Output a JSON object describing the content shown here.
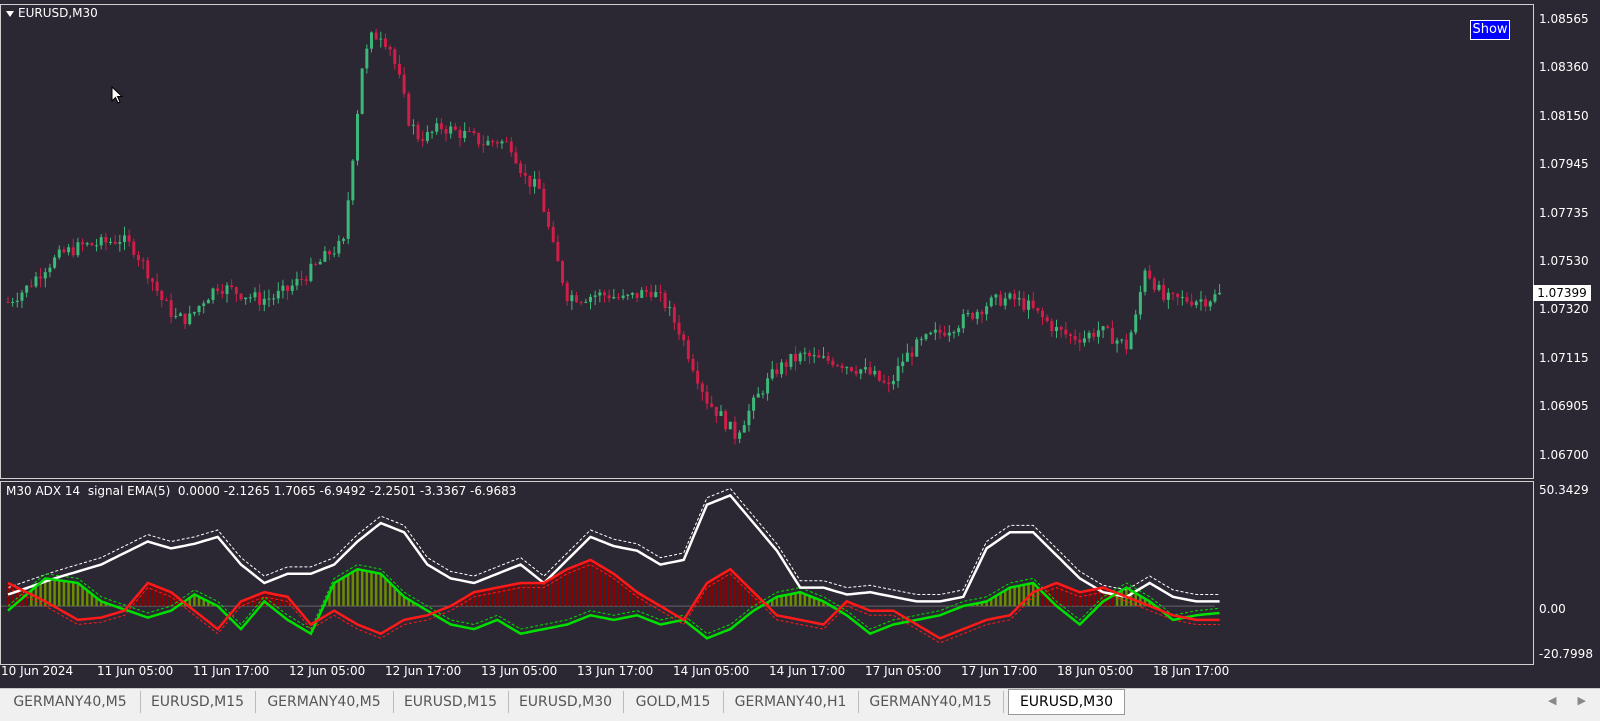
{
  "chart_title": "EURUSD,M30",
  "show_button": "Show",
  "indicator_label": "M30 ADX 14  signal EMA(5)  0.0000 -2.1265 1.7065 -6.9492 -2.2501 -3.3367 -6.9683",
  "price_axis": [
    "1.08565",
    "1.08360",
    "1.08150",
    "1.07945",
    "1.07735",
    "1.07530",
    "1.07320",
    "1.07115",
    "1.06905",
    "1.06700"
  ],
  "current_price": "1.07399",
  "indicator_axis": [
    "50.3429",
    "0.00",
    "-20.7998"
  ],
  "time_axis": [
    "10 Jun 2024",
    "11 Jun 05:00",
    "11 Jun 17:00",
    "12 Jun 05:00",
    "12 Jun 17:00",
    "13 Jun 05:00",
    "13 Jun 17:00",
    "14 Jun 05:00",
    "14 Jun 17:00",
    "17 Jun 05:00",
    "17 Jun 17:00",
    "18 Jun 05:00",
    "18 Jun 17:00"
  ],
  "tabs": [
    {
      "label": "GERMANY40,M5",
      "active": false
    },
    {
      "label": "EURUSD,M15",
      "active": false
    },
    {
      "label": "GERMANY40,M5",
      "active": false
    },
    {
      "label": "EURUSD,M15",
      "active": false
    },
    {
      "label": "EURUSD,M30",
      "active": false
    },
    {
      "label": "GOLD,M15",
      "active": false
    },
    {
      "label": "GERMANY40,H1",
      "active": false
    },
    {
      "label": "GERMANY40,M15",
      "active": false
    },
    {
      "label": "EURUSD,M30",
      "active": true
    }
  ],
  "colors": {
    "background": "#2b2733",
    "bull": "#3cb878",
    "bear": "#d01e48",
    "adx": "#ffffff",
    "plus_di": "#00e000",
    "minus_di": "#ff1a1a",
    "hist_bull": "#6b8c00",
    "hist_bear": "#8b0000",
    "accent": "#0000ff"
  },
  "chart_data": {
    "type": "candlestick",
    "ylim": [
      1.0665,
      1.0862
    ],
    "price_path": [
      [
        0,
        1.0737
      ],
      [
        4,
        1.0743
      ],
      [
        8,
        1.0752
      ],
      [
        12,
        1.0758
      ],
      [
        16,
        1.0761
      ],
      [
        20,
        1.0762
      ],
      [
        24,
        1.0764
      ],
      [
        27,
        1.076
      ],
      [
        30,
        1.075
      ],
      [
        33,
        1.0738
      ],
      [
        36,
        1.073
      ],
      [
        39,
        1.073
      ],
      [
        42,
        1.0738
      ],
      [
        45,
        1.0744
      ],
      [
        48,
        1.0742
      ],
      [
        51,
        1.074
      ],
      [
        54,
        1.0738
      ],
      [
        57,
        1.0739
      ],
      [
        60,
        1.0742
      ],
      [
        63,
        1.0747
      ],
      [
        66,
        1.0752
      ],
      [
        69,
        1.0758
      ],
      [
        72,
        1.0762
      ],
      [
        74,
        1.08
      ],
      [
        76,
        1.0838
      ],
      [
        78,
        1.085
      ],
      [
        80,
        1.0852
      ],
      [
        82,
        1.0846
      ],
      [
        84,
        1.0832
      ],
      [
        86,
        1.0815
      ],
      [
        88,
        1.0808
      ],
      [
        90,
        1.0808
      ],
      [
        93,
        1.0812
      ],
      [
        96,
        1.081
      ],
      [
        99,
        1.0808
      ],
      [
        102,
        1.0805
      ],
      [
        105,
        1.0806
      ],
      [
        108,
        1.0804
      ],
      [
        111,
        1.079
      ],
      [
        114,
        1.0785
      ],
      [
        117,
        1.076
      ],
      [
        120,
        1.074
      ],
      [
        123,
        1.0739
      ],
      [
        126,
        1.074
      ],
      [
        129,
        1.074
      ],
      [
        132,
        1.0738
      ],
      [
        135,
        1.074
      ],
      [
        138,
        1.0742
      ],
      [
        141,
        1.0736
      ],
      [
        144,
        1.0725
      ],
      [
        147,
        1.071
      ],
      [
        150,
        1.0695
      ],
      [
        153,
        1.0688
      ],
      [
        156,
        1.068
      ],
      [
        159,
        1.069
      ],
      [
        162,
        1.07
      ],
      [
        165,
        1.0708
      ],
      [
        168,
        1.0712
      ],
      [
        171,
        1.0714
      ],
      [
        174,
        1.0712
      ],
      [
        177,
        1.0712
      ],
      [
        180,
        1.071
      ],
      [
        183,
        1.0708
      ],
      [
        186,
        1.0705
      ],
      [
        189,
        1.07
      ],
      [
        192,
        1.0712
      ],
      [
        195,
        1.0718
      ],
      [
        198,
        1.0722
      ],
      [
        201,
        1.0725
      ],
      [
        204,
        1.0728
      ],
      [
        207,
        1.0732
      ],
      [
        210,
        1.0736
      ],
      [
        213,
        1.0738
      ],
      [
        216,
        1.0738
      ],
      [
        219,
        1.0735
      ],
      [
        222,
        1.073
      ],
      [
        225,
        1.0725
      ],
      [
        228,
        1.0722
      ],
      [
        231,
        1.0722
      ],
      [
        234,
        1.0725
      ],
      [
        237,
        1.0722
      ],
      [
        240,
        1.0718
      ],
      [
        242,
        1.073
      ],
      [
        244,
        1.0752
      ],
      [
        246,
        1.0745
      ],
      [
        248,
        1.0738
      ],
      [
        251,
        1.0738
      ],
      [
        254,
        1.0738
      ],
      [
        257,
        1.0738
      ],
      [
        260,
        1.074
      ]
    ],
    "adx_path": [
      [
        0,
        5
      ],
      [
        10,
        12
      ],
      [
        20,
        18
      ],
      [
        30,
        28
      ],
      [
        35,
        25
      ],
      [
        40,
        27
      ],
      [
        45,
        30
      ],
      [
        50,
        18
      ],
      [
        55,
        10
      ],
      [
        60,
        14
      ],
      [
        65,
        14
      ],
      [
        70,
        18
      ],
      [
        75,
        28
      ],
      [
        80,
        36
      ],
      [
        85,
        32
      ],
      [
        90,
        18
      ],
      [
        95,
        12
      ],
      [
        100,
        10
      ],
      [
        105,
        14
      ],
      [
        110,
        18
      ],
      [
        115,
        10
      ],
      [
        120,
        20
      ],
      [
        125,
        30
      ],
      [
        130,
        26
      ],
      [
        135,
        24
      ],
      [
        140,
        18
      ],
      [
        145,
        20
      ],
      [
        150,
        44
      ],
      [
        155,
        48
      ],
      [
        160,
        36
      ],
      [
        165,
        24
      ],
      [
        170,
        8
      ],
      [
        175,
        8
      ],
      [
        180,
        5
      ],
      [
        185,
        6
      ],
      [
        190,
        4
      ],
      [
        195,
        2
      ],
      [
        200,
        2
      ],
      [
        205,
        4
      ],
      [
        210,
        25
      ],
      [
        215,
        32
      ],
      [
        220,
        32
      ],
      [
        225,
        22
      ],
      [
        230,
        12
      ],
      [
        235,
        6
      ],
      [
        240,
        4
      ],
      [
        245,
        10
      ],
      [
        250,
        4
      ],
      [
        255,
        2
      ],
      [
        260,
        2
      ]
    ],
    "plus_di_path": [
      [
        0,
        -2
      ],
      [
        8,
        12
      ],
      [
        15,
        10
      ],
      [
        20,
        2
      ],
      [
        30,
        -5
      ],
      [
        35,
        -2
      ],
      [
        40,
        5
      ],
      [
        45,
        0
      ],
      [
        50,
        -10
      ],
      [
        55,
        2
      ],
      [
        60,
        -6
      ],
      [
        65,
        -12
      ],
      [
        70,
        10
      ],
      [
        75,
        16
      ],
      [
        80,
        14
      ],
      [
        85,
        4
      ],
      [
        90,
        -2
      ],
      [
        95,
        -8
      ],
      [
        100,
        -10
      ],
      [
        105,
        -6
      ],
      [
        110,
        -12
      ],
      [
        115,
        -10
      ],
      [
        120,
        -8
      ],
      [
        125,
        -4
      ],
      [
        130,
        -6
      ],
      [
        135,
        -4
      ],
      [
        140,
        -8
      ],
      [
        145,
        -6
      ],
      [
        150,
        -14
      ],
      [
        155,
        -10
      ],
      [
        160,
        -2
      ],
      [
        165,
        4
      ],
      [
        170,
        6
      ],
      [
        175,
        2
      ],
      [
        180,
        -4
      ],
      [
        185,
        -12
      ],
      [
        190,
        -8
      ],
      [
        195,
        -6
      ],
      [
        200,
        -4
      ],
      [
        205,
        0
      ],
      [
        210,
        2
      ],
      [
        215,
        8
      ],
      [
        220,
        10
      ],
      [
        225,
        0
      ],
      [
        230,
        -8
      ],
      [
        235,
        2
      ],
      [
        240,
        8
      ],
      [
        245,
        2
      ],
      [
        250,
        -6
      ],
      [
        255,
        -4
      ],
      [
        260,
        -3
      ]
    ],
    "minus_di_path": [
      [
        0,
        10
      ],
      [
        8,
        2
      ],
      [
        15,
        -6
      ],
      [
        20,
        -5
      ],
      [
        25,
        -2
      ],
      [
        30,
        10
      ],
      [
        35,
        6
      ],
      [
        40,
        -2
      ],
      [
        45,
        -10
      ],
      [
        50,
        2
      ],
      [
        55,
        6
      ],
      [
        60,
        4
      ],
      [
        65,
        -8
      ],
      [
        70,
        -2
      ],
      [
        75,
        -8
      ],
      [
        80,
        -12
      ],
      [
        85,
        -6
      ],
      [
        90,
        -4
      ],
      [
        95,
        0
      ],
      [
        100,
        6
      ],
      [
        105,
        8
      ],
      [
        110,
        10
      ],
      [
        115,
        10
      ],
      [
        120,
        16
      ],
      [
        125,
        20
      ],
      [
        130,
        14
      ],
      [
        135,
        6
      ],
      [
        140,
        0
      ],
      [
        145,
        -6
      ],
      [
        150,
        10
      ],
      [
        155,
        16
      ],
      [
        160,
        6
      ],
      [
        165,
        -4
      ],
      [
        170,
        -6
      ],
      [
        175,
        -8
      ],
      [
        180,
        2
      ],
      [
        185,
        -2
      ],
      [
        190,
        -2
      ],
      [
        195,
        -8
      ],
      [
        200,
        -14
      ],
      [
        205,
        -10
      ],
      [
        210,
        -6
      ],
      [
        215,
        -4
      ],
      [
        220,
        6
      ],
      [
        225,
        10
      ],
      [
        230,
        6
      ],
      [
        235,
        8
      ],
      [
        240,
        4
      ],
      [
        245,
        0
      ],
      [
        250,
        -4
      ],
      [
        255,
        -6
      ],
      [
        260,
        -6
      ]
    ]
  }
}
